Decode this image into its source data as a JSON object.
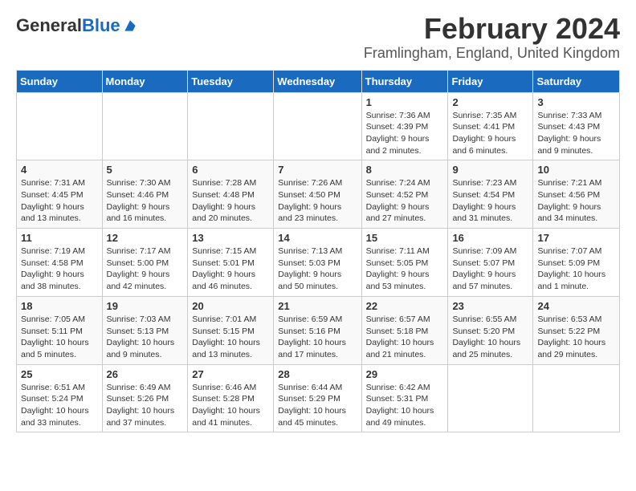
{
  "logo": {
    "general": "General",
    "blue": "Blue"
  },
  "header": {
    "title": "February 2024",
    "subtitle": "Framlingham, England, United Kingdom"
  },
  "weekdays": [
    "Sunday",
    "Monday",
    "Tuesday",
    "Wednesday",
    "Thursday",
    "Friday",
    "Saturday"
  ],
  "weeks": [
    [
      {
        "day": "",
        "info": ""
      },
      {
        "day": "",
        "info": ""
      },
      {
        "day": "",
        "info": ""
      },
      {
        "day": "",
        "info": ""
      },
      {
        "day": "1",
        "info": "Sunrise: 7:36 AM\nSunset: 4:39 PM\nDaylight: 9 hours\nand 2 minutes."
      },
      {
        "day": "2",
        "info": "Sunrise: 7:35 AM\nSunset: 4:41 PM\nDaylight: 9 hours\nand 6 minutes."
      },
      {
        "day": "3",
        "info": "Sunrise: 7:33 AM\nSunset: 4:43 PM\nDaylight: 9 hours\nand 9 minutes."
      }
    ],
    [
      {
        "day": "4",
        "info": "Sunrise: 7:31 AM\nSunset: 4:45 PM\nDaylight: 9 hours\nand 13 minutes."
      },
      {
        "day": "5",
        "info": "Sunrise: 7:30 AM\nSunset: 4:46 PM\nDaylight: 9 hours\nand 16 minutes."
      },
      {
        "day": "6",
        "info": "Sunrise: 7:28 AM\nSunset: 4:48 PM\nDaylight: 9 hours\nand 20 minutes."
      },
      {
        "day": "7",
        "info": "Sunrise: 7:26 AM\nSunset: 4:50 PM\nDaylight: 9 hours\nand 23 minutes."
      },
      {
        "day": "8",
        "info": "Sunrise: 7:24 AM\nSunset: 4:52 PM\nDaylight: 9 hours\nand 27 minutes."
      },
      {
        "day": "9",
        "info": "Sunrise: 7:23 AM\nSunset: 4:54 PM\nDaylight: 9 hours\nand 31 minutes."
      },
      {
        "day": "10",
        "info": "Sunrise: 7:21 AM\nSunset: 4:56 PM\nDaylight: 9 hours\nand 34 minutes."
      }
    ],
    [
      {
        "day": "11",
        "info": "Sunrise: 7:19 AM\nSunset: 4:58 PM\nDaylight: 9 hours\nand 38 minutes."
      },
      {
        "day": "12",
        "info": "Sunrise: 7:17 AM\nSunset: 5:00 PM\nDaylight: 9 hours\nand 42 minutes."
      },
      {
        "day": "13",
        "info": "Sunrise: 7:15 AM\nSunset: 5:01 PM\nDaylight: 9 hours\nand 46 minutes."
      },
      {
        "day": "14",
        "info": "Sunrise: 7:13 AM\nSunset: 5:03 PM\nDaylight: 9 hours\nand 50 minutes."
      },
      {
        "day": "15",
        "info": "Sunrise: 7:11 AM\nSunset: 5:05 PM\nDaylight: 9 hours\nand 53 minutes."
      },
      {
        "day": "16",
        "info": "Sunrise: 7:09 AM\nSunset: 5:07 PM\nDaylight: 9 hours\nand 57 minutes."
      },
      {
        "day": "17",
        "info": "Sunrise: 7:07 AM\nSunset: 5:09 PM\nDaylight: 10 hours\nand 1 minute."
      }
    ],
    [
      {
        "day": "18",
        "info": "Sunrise: 7:05 AM\nSunset: 5:11 PM\nDaylight: 10 hours\nand 5 minutes."
      },
      {
        "day": "19",
        "info": "Sunrise: 7:03 AM\nSunset: 5:13 PM\nDaylight: 10 hours\nand 9 minutes."
      },
      {
        "day": "20",
        "info": "Sunrise: 7:01 AM\nSunset: 5:15 PM\nDaylight: 10 hours\nand 13 minutes."
      },
      {
        "day": "21",
        "info": "Sunrise: 6:59 AM\nSunset: 5:16 PM\nDaylight: 10 hours\nand 17 minutes."
      },
      {
        "day": "22",
        "info": "Sunrise: 6:57 AM\nSunset: 5:18 PM\nDaylight: 10 hours\nand 21 minutes."
      },
      {
        "day": "23",
        "info": "Sunrise: 6:55 AM\nSunset: 5:20 PM\nDaylight: 10 hours\nand 25 minutes."
      },
      {
        "day": "24",
        "info": "Sunrise: 6:53 AM\nSunset: 5:22 PM\nDaylight: 10 hours\nand 29 minutes."
      }
    ],
    [
      {
        "day": "25",
        "info": "Sunrise: 6:51 AM\nSunset: 5:24 PM\nDaylight: 10 hours\nand 33 minutes."
      },
      {
        "day": "26",
        "info": "Sunrise: 6:49 AM\nSunset: 5:26 PM\nDaylight: 10 hours\nand 37 minutes."
      },
      {
        "day": "27",
        "info": "Sunrise: 6:46 AM\nSunset: 5:28 PM\nDaylight: 10 hours\nand 41 minutes."
      },
      {
        "day": "28",
        "info": "Sunrise: 6:44 AM\nSunset: 5:29 PM\nDaylight: 10 hours\nand 45 minutes."
      },
      {
        "day": "29",
        "info": "Sunrise: 6:42 AM\nSunset: 5:31 PM\nDaylight: 10 hours\nand 49 minutes."
      },
      {
        "day": "",
        "info": ""
      },
      {
        "day": "",
        "info": ""
      }
    ]
  ]
}
